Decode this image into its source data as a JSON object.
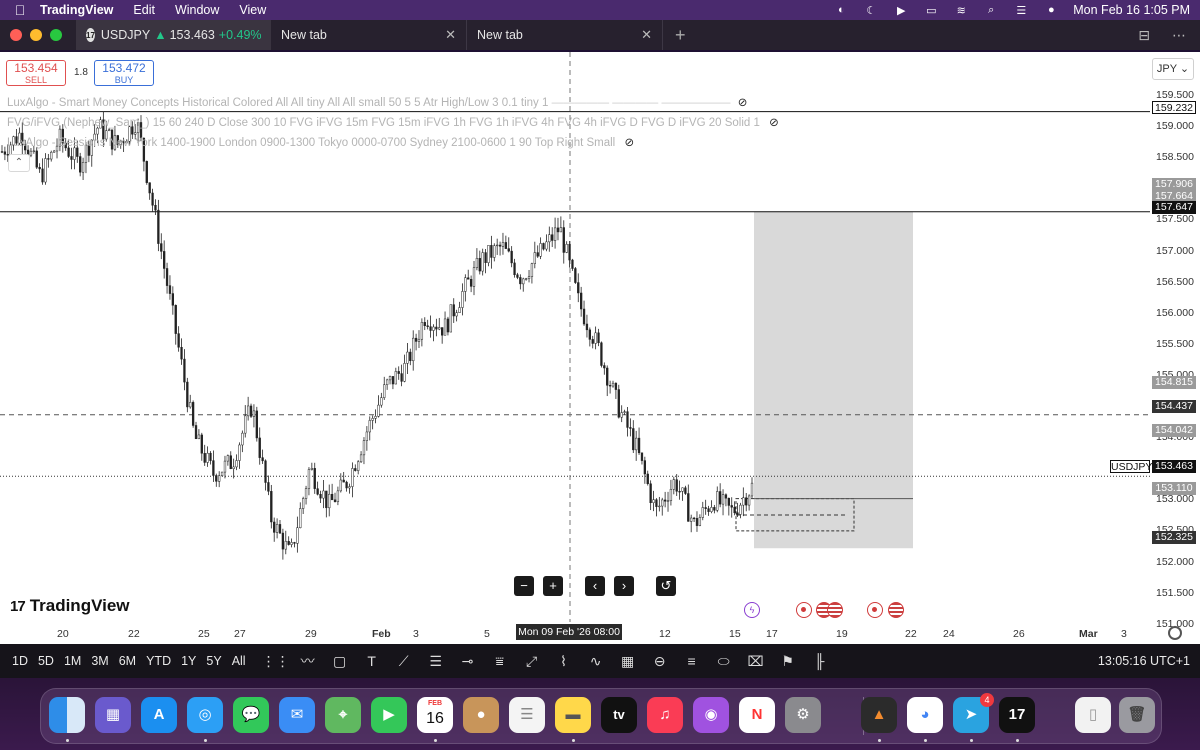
{
  "menubar": {
    "app_name": "TradingView",
    "items": [
      "Edit",
      "Window",
      "View"
    ],
    "clock": "Mon Feb 16  1:05 PM"
  },
  "tabs": [
    {
      "symbol": "USDJPY",
      "arrow": "▲",
      "price": "153.463",
      "change": "+0.49%"
    },
    {
      "label": "New tab"
    },
    {
      "label": "New tab"
    }
  ],
  "trade": {
    "sell_price": "153.454",
    "sell_label": "SELL",
    "spread": "1.8",
    "buy_price": "153.472",
    "buy_label": "BUY"
  },
  "indicators": [
    "LuxAlgo - Smart Money Concepts Historical Colored All All tiny All All small 50 5 5 Atr High/Low 3 0.1 tiny 1",
    "FVG/iFVG (Nephew_Sam_) 15 60 240 D Close 300 10 FVG iFVG 15m FVG 15m iFVG 1h FVG 1h iFVG 4h FVG 4h iFVG D FVG D iFVG 20 Solid 1",
    "LuxAlgo - Sessions New York 1400-1900 London 0900-1300 Tokyo 0000-0700 Sydney 2100-0600 1 90 Top Right Small"
  ],
  "currency": "JPY",
  "price_ticks": [
    "159.500",
    "159.000",
    "158.500",
    "158.000",
    "157.500",
    "157.000",
    "156.500",
    "156.000",
    "155.500",
    "155.000",
    "154.500",
    "154.000",
    "153.500",
    "153.000",
    "152.500",
    "152.000",
    "151.500",
    "151.000"
  ],
  "price_badges": {
    "level_top": "159.232",
    "b1": "157.906",
    "b2": "157.664",
    "level_mid": "157.647",
    "b3": "154.815",
    "b4": "154.437",
    "b5": "154.042",
    "symbol_label": "USDJPY",
    "current": "153.463",
    "b6": "153.110",
    "b7": "152.325"
  },
  "date_ticks": [
    "20",
    "22",
    "25",
    "27",
    "29",
    "Feb",
    "3",
    "5",
    "12",
    "15",
    "17",
    "19",
    "22",
    "24",
    "26",
    "Mar",
    "3"
  ],
  "crosshair_date": "Mon 09 Feb '26  08:00",
  "brand": "TradingView",
  "timeframes": [
    "1D",
    "5D",
    "1M",
    "3M",
    "6M",
    "YTD",
    "1Y",
    "5Y",
    "All"
  ],
  "clock_utc": "13:05:16 UTC+1",
  "dock": {
    "calendar_month": "FEB",
    "calendar_day": "16",
    "telegram_badge": "4",
    "tv_label": "tv"
  },
  "colors": {
    "sell": "#e05050",
    "buy": "#3a6fd8",
    "candle": "#222222",
    "position_box": "#d9d9d9",
    "chart_bg": "#ffffff"
  },
  "chart_data": {
    "type": "candlestick",
    "title": "",
    "symbol": "USDJPY",
    "ylim": [
      151.0,
      159.7
    ],
    "grid": false,
    "close_path": [
      158.6,
      158.9,
      158.2,
      158.8,
      158.4,
      159.0,
      158.7,
      159.1,
      157.5,
      155.8,
      154.1,
      153.5,
      153.7,
      154.6,
      152.8,
      152.2,
      153.6,
      153.0,
      153.4,
      154.2,
      154.9,
      155.2,
      156.0,
      155.8,
      156.4,
      156.9,
      157.1,
      156.6,
      157.0,
      157.4,
      156.2,
      155.5,
      154.6,
      153.9,
      152.9,
      153.4,
      152.7,
      153.1,
      152.9,
      153.3
    ]
  }
}
